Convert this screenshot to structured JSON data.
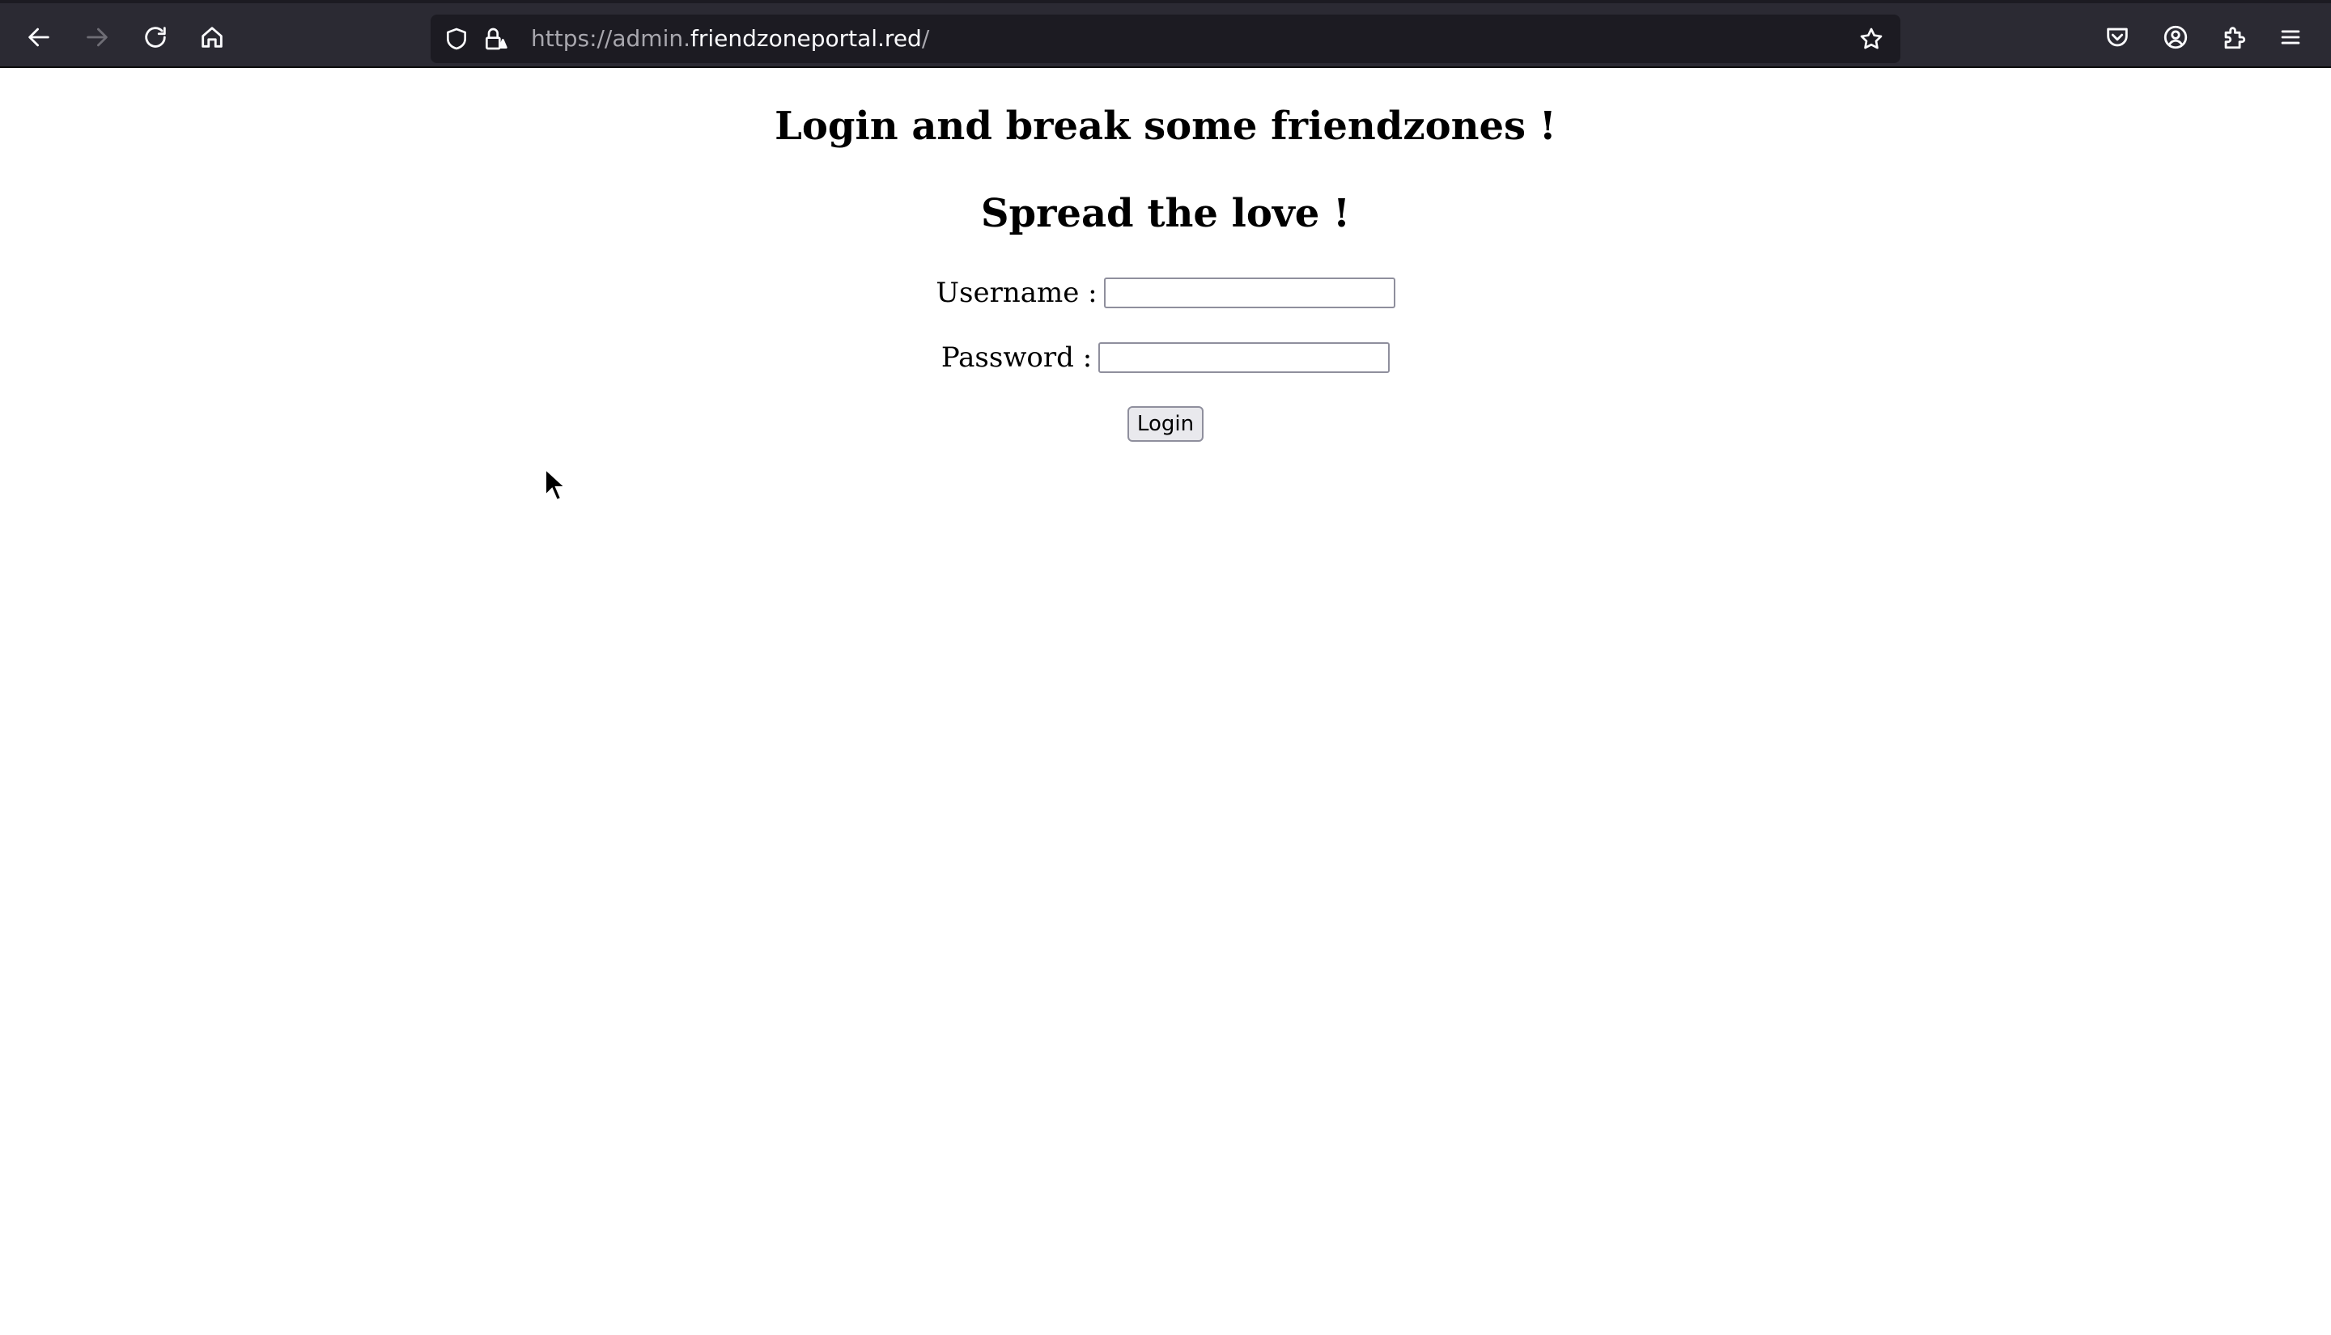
{
  "browser": {
    "url_prefix": "https://admin.",
    "url_domain": "friendzoneportal.red",
    "url_suffix": "/",
    "icons": {
      "back": "back-arrow-icon",
      "forward": "forward-arrow-icon",
      "reload": "reload-icon",
      "home": "home-icon",
      "tracking_protection": "shield-icon",
      "connection": "lock-warning-icon",
      "bookmark": "star-icon",
      "pocket": "pocket-icon",
      "account": "account-icon",
      "extensions": "puzzle-icon",
      "menu": "hamburger-menu-icon"
    },
    "colors": {
      "toolbar": "#2b2a33",
      "urlbar": "#1c1b22"
    }
  },
  "page": {
    "heading": "Login and break some friendzones !",
    "subheading": "Spread the love !",
    "username_label": "Username :",
    "username_value": "",
    "password_label": "Password :",
    "password_value": "",
    "login_button": "Login"
  }
}
